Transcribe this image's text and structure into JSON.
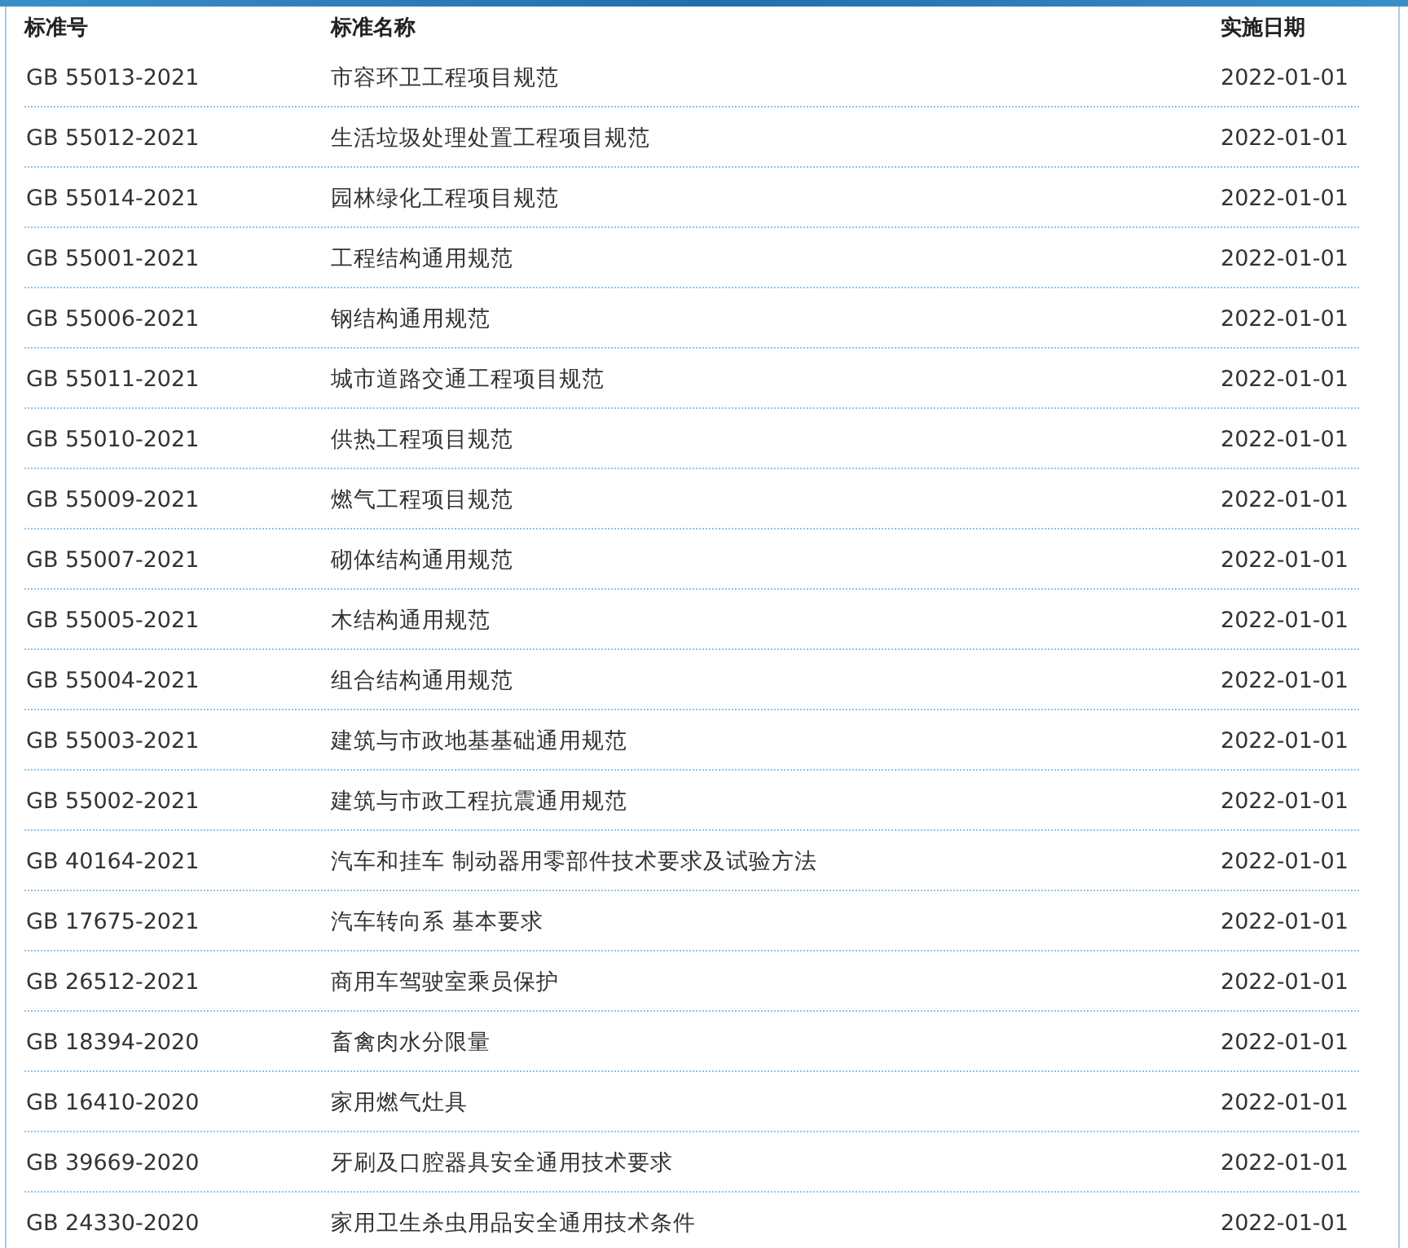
{
  "table": {
    "columns": [
      "标准号",
      "标准名称",
      "实施日期"
    ],
    "rows": [
      {
        "code": "GB 55013-2021",
        "name": "市容环卫工程项目规范",
        "date": "2022-01-01"
      },
      {
        "code": "GB 55012-2021",
        "name": "生活垃圾处理处置工程项目规范",
        "date": "2022-01-01"
      },
      {
        "code": "GB 55014-2021",
        "name": "园林绿化工程项目规范",
        "date": "2022-01-01"
      },
      {
        "code": "GB 55001-2021",
        "name": "工程结构通用规范",
        "date": "2022-01-01"
      },
      {
        "code": "GB 55006-2021",
        "name": "钢结构通用规范",
        "date": "2022-01-01"
      },
      {
        "code": "GB 55011-2021",
        "name": "城市道路交通工程项目规范",
        "date": "2022-01-01"
      },
      {
        "code": "GB 55010-2021",
        "name": "供热工程项目规范",
        "date": "2022-01-01"
      },
      {
        "code": "GB 55009-2021",
        "name": "燃气工程项目规范",
        "date": "2022-01-01"
      },
      {
        "code": "GB 55007-2021",
        "name": "砌体结构通用规范",
        "date": "2022-01-01"
      },
      {
        "code": "GB 55005-2021",
        "name": "木结构通用规范",
        "date": "2022-01-01"
      },
      {
        "code": "GB 55004-2021",
        "name": "组合结构通用规范",
        "date": "2022-01-01"
      },
      {
        "code": "GB 55003-2021",
        "name": "建筑与市政地基基础通用规范",
        "date": "2022-01-01"
      },
      {
        "code": "GB 55002-2021",
        "name": "建筑与市政工程抗震通用规范",
        "date": "2022-01-01"
      },
      {
        "code": "GB 40164-2021",
        "name": "汽车和挂车 制动器用零部件技术要求及试验方法",
        "date": "2022-01-01"
      },
      {
        "code": "GB 17675-2021",
        "name": "汽车转向系 基本要求",
        "date": "2022-01-01"
      },
      {
        "code": "GB 26512-2021",
        "name": "商用车驾驶室乘员保护",
        "date": "2022-01-01"
      },
      {
        "code": "GB 18394-2020",
        "name": "畜禽肉水分限量",
        "date": "2022-01-01"
      },
      {
        "code": "GB 16410-2020",
        "name": "家用燃气灶具",
        "date": "2022-01-01"
      },
      {
        "code": "GB 39669-2020",
        "name": "牙刷及口腔器具安全通用技术要求",
        "date": "2022-01-01"
      },
      {
        "code": "GB 24330-2020",
        "name": "家用卫生杀虫用品安全通用技术条件",
        "date": "2022-01-01"
      }
    ]
  }
}
